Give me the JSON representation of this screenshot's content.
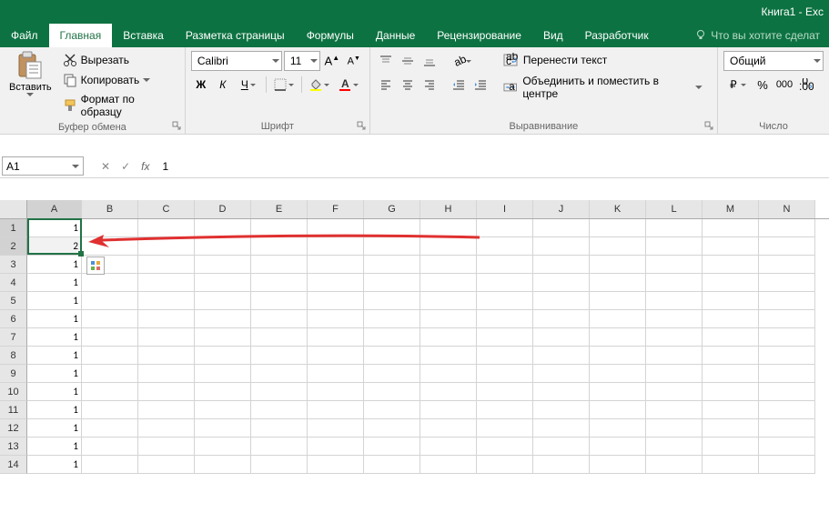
{
  "titlebar": {
    "text": "Книга1 - Exc"
  },
  "menu": {
    "file": "Файл",
    "home": "Главная",
    "insert": "Вставка",
    "layout": "Разметка страницы",
    "formulas": "Формулы",
    "data": "Данные",
    "review": "Рецензирование",
    "view": "Вид",
    "developer": "Разработчик",
    "tellme": "Что вы хотите сделат"
  },
  "ribbon": {
    "clipboard": {
      "paste": "Вставить",
      "cut": "Вырезать",
      "copy": "Копировать",
      "format_painter": "Формат по образцу",
      "label": "Буфер обмена"
    },
    "font": {
      "name": "Calibri",
      "size": "11",
      "label": "Шрифт",
      "bold": "Ж",
      "italic": "К",
      "underline": "Ч"
    },
    "alignment": {
      "wrap": "Перенести текст",
      "merge": "Объединить и поместить в центре",
      "label": "Выравнивание"
    },
    "number": {
      "format": "Общий",
      "label": "Число"
    }
  },
  "formula_bar": {
    "name_box": "A1",
    "value": "1"
  },
  "grid": {
    "columns": [
      "A",
      "B",
      "C",
      "D",
      "E",
      "F",
      "G",
      "H",
      "I",
      "J",
      "K",
      "L",
      "M",
      "N"
    ],
    "rows": [
      {
        "n": "1",
        "A": "1"
      },
      {
        "n": "2",
        "A": "2"
      },
      {
        "n": "3",
        "A": "1"
      },
      {
        "n": "4",
        "A": "1"
      },
      {
        "n": "5",
        "A": "1"
      },
      {
        "n": "6",
        "A": "1"
      },
      {
        "n": "7",
        "A": "1"
      },
      {
        "n": "8",
        "A": "1"
      },
      {
        "n": "9",
        "A": "1"
      },
      {
        "n": "10",
        "A": "1"
      },
      {
        "n": "11",
        "A": "1"
      },
      {
        "n": "12",
        "A": "1"
      },
      {
        "n": "13",
        "A": "1"
      },
      {
        "n": "14",
        "A": "1"
      }
    ],
    "selected_cell": "A1",
    "highlighted_cell": "A2"
  }
}
